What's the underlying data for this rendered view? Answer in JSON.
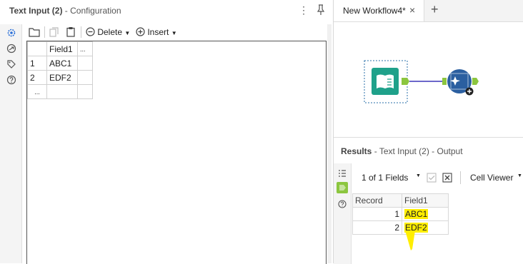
{
  "config": {
    "title": "Text Input (2)",
    "subtitle": "- Configuration",
    "menu_icon": "⋮",
    "toolbar": {
      "delete_label": "Delete",
      "insert_label": "Insert"
    },
    "grid": {
      "header_field": "Field1",
      "header_more": "...",
      "rows": [
        {
          "num": "1",
          "value": "ABC1"
        },
        {
          "num": "2",
          "value": "EDF2"
        }
      ],
      "new_row_marker": "..."
    }
  },
  "workflow": {
    "tab_label": "New Workflow4*",
    "tab_close": "×",
    "tab_add": "+"
  },
  "results": {
    "title": "Results",
    "subtitle": "- Text Input (2) - Output",
    "fields_label": "1 of 1 Fields",
    "viewer_label": "Cell Viewer",
    "columns": [
      "Record",
      "Field1"
    ],
    "rows": [
      {
        "record": "1",
        "field1": "ABC1"
      },
      {
        "record": "2",
        "field1": "EDF2"
      }
    ],
    "highlight_color": "#ffee00"
  }
}
